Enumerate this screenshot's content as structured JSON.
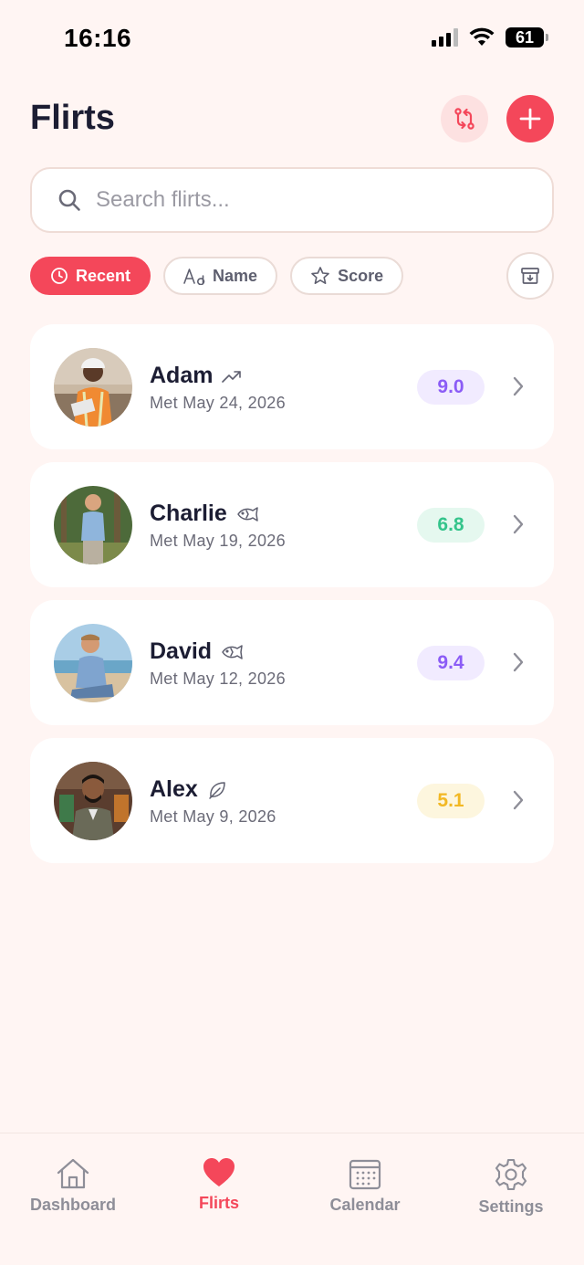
{
  "status_bar": {
    "time": "16:16",
    "battery": "61"
  },
  "header": {
    "title": "Flirts"
  },
  "search": {
    "placeholder": "Search flirts..."
  },
  "filters": [
    {
      "label": "Recent",
      "icon": "clock-icon",
      "active": true
    },
    {
      "label": "Name",
      "icon": "text-icon",
      "active": false
    },
    {
      "label": "Score",
      "icon": "star-icon",
      "active": false
    }
  ],
  "flirts": [
    {
      "name": "Adam",
      "met": "Met May 24, 2026",
      "score": "9.0",
      "status_icon": "trending-up-icon",
      "score_color": "#8b5cf6",
      "score_bg": "#f1ebff"
    },
    {
      "name": "Charlie",
      "met": "Met May 19, 2026",
      "score": "6.8",
      "status_icon": "fish-icon",
      "score_color": "#34c48b",
      "score_bg": "#e5f8ef"
    },
    {
      "name": "David",
      "met": "Met May 12, 2026",
      "score": "9.4",
      "status_icon": "fish-icon",
      "score_color": "#8b5cf6",
      "score_bg": "#f1ebff"
    },
    {
      "name": "Alex",
      "met": "Met May 9, 2026",
      "score": "5.1",
      "status_icon": "leaf-icon",
      "score_color": "#f2b824",
      "score_bg": "#fdf6de"
    }
  ],
  "tabs": [
    {
      "label": "Dashboard",
      "icon": "home-icon"
    },
    {
      "label": "Flirts",
      "icon": "heart-icon"
    },
    {
      "label": "Calendar",
      "icon": "calendar-icon"
    },
    {
      "label": "Settings",
      "icon": "gear-icon"
    }
  ],
  "colors": {
    "accent": "#f4475a",
    "background": "#fff5f3",
    "text": "#1c1d33"
  }
}
